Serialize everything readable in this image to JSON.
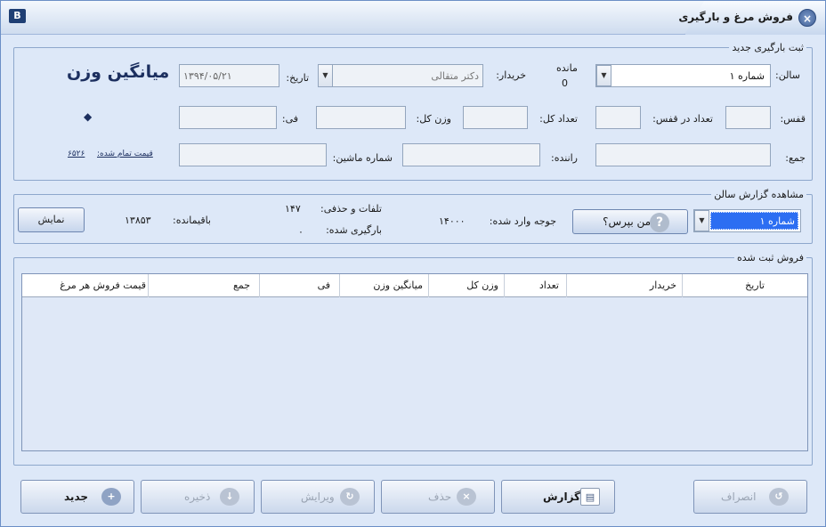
{
  "window": {
    "title": "فروش مرغ و بارگیری",
    "app_badge": "B"
  },
  "new_loading": {
    "legend": "ثبت بارگیری جدید",
    "salon_label": "سالن:",
    "salon_value": "شماره ۱",
    "remaining_label": "مانده",
    "remaining_value": "0",
    "buyer_label": "خریدار:",
    "buyer_value": "دکتر متقالی",
    "date_label": "تاریخ:",
    "date_value": "۱۳۹۴/۰۵/۲۱",
    "avg_weight_title": "میانگین وزن",
    "diamond": "◆",
    "cage_label": "قفس:",
    "count_in_cage_label": "تعداد در قفس:",
    "total_count_label": "تعداد کل:",
    "total_weight_label": "وزن کل:",
    "fee_label": "فی:",
    "sum_label": "جمع:",
    "driver_label": "راننده:",
    "vehicle_no_label": "شماره ماشین:",
    "final_price_label": "قیمت تمام شده:",
    "final_price_value": "۶۵۲۶"
  },
  "salon_report": {
    "legend": "مشاهده گزارش سالن",
    "salon_value": "شماره ۱",
    "ask_me_button": "از من بپرس؟",
    "chicks_in_label": "جوجه وارد شده:",
    "chicks_in_value": "۱۴۰۰۰",
    "losses_label": "تلفات و حذفی:",
    "losses_value": "۱۴۷",
    "loaded_label": "بارگیری شده:",
    "loaded_value": "۰",
    "remaining_label": "باقیمانده:",
    "remaining_value": "۱۳۸۵۳",
    "show_button": "نمایش"
  },
  "registered_sales": {
    "legend": "فروش ثبت شده",
    "columns": [
      "تاریخ",
      "خریدار",
      "تعداد",
      "وزن کل",
      "میانگین وزن",
      "فی",
      "جمع",
      "قیمت فروش هر مرغ"
    ]
  },
  "buttons": {
    "new": "جدید",
    "save": "ذخیره",
    "edit": "ویرایش",
    "delete": "حذف",
    "report": "گزارش",
    "cancel": "انصراف"
  },
  "icons": {
    "close": "×",
    "dropdown": "▼",
    "question": "?",
    "new": "+",
    "save": "↓",
    "edit": "↻",
    "delete": "×",
    "report": "▤",
    "cancel": "↺"
  }
}
